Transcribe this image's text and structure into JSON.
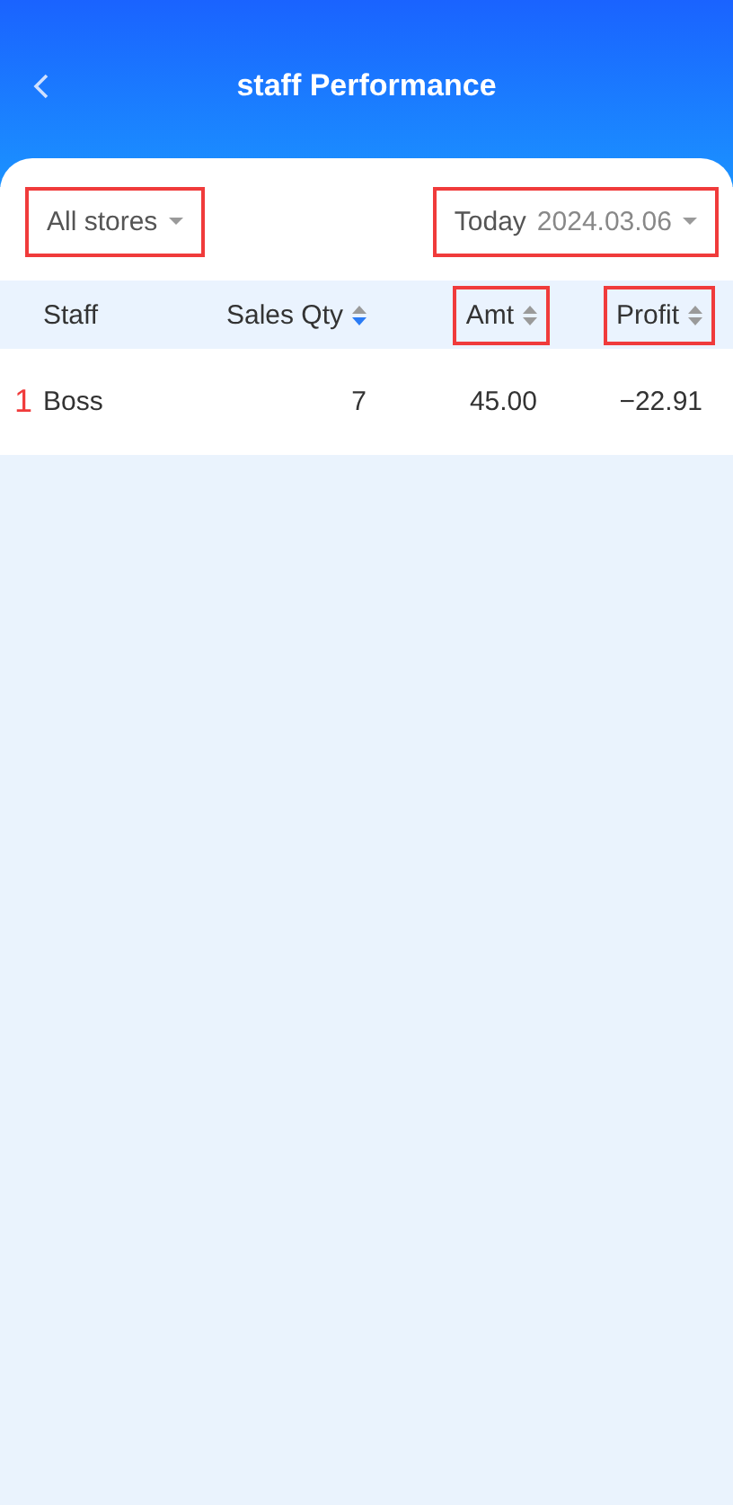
{
  "header": {
    "title": "staff Performance"
  },
  "filters": [
    {
      "label": "All stores",
      "highlighted": true
    },
    {
      "label": "Today",
      "value": "2024.03.06",
      "highlighted": true
    }
  ],
  "table": {
    "columns": [
      {
        "label": "Staff",
        "kind": "plain",
        "highlighted": false
      },
      {
        "label": "Sales Qty",
        "kind": "sortable",
        "sorted": true,
        "highlighted": false
      },
      {
        "label": "Amt",
        "kind": "sortable",
        "sorted": false,
        "highlighted": true
      },
      {
        "label": "Profit",
        "kind": "sortable",
        "sorted": false,
        "highlighted": true
      }
    ],
    "rows": [
      {
        "rank": "1",
        "cells": [
          "Boss",
          "7",
          "45.00",
          "−22.91"
        ]
      }
    ]
  }
}
